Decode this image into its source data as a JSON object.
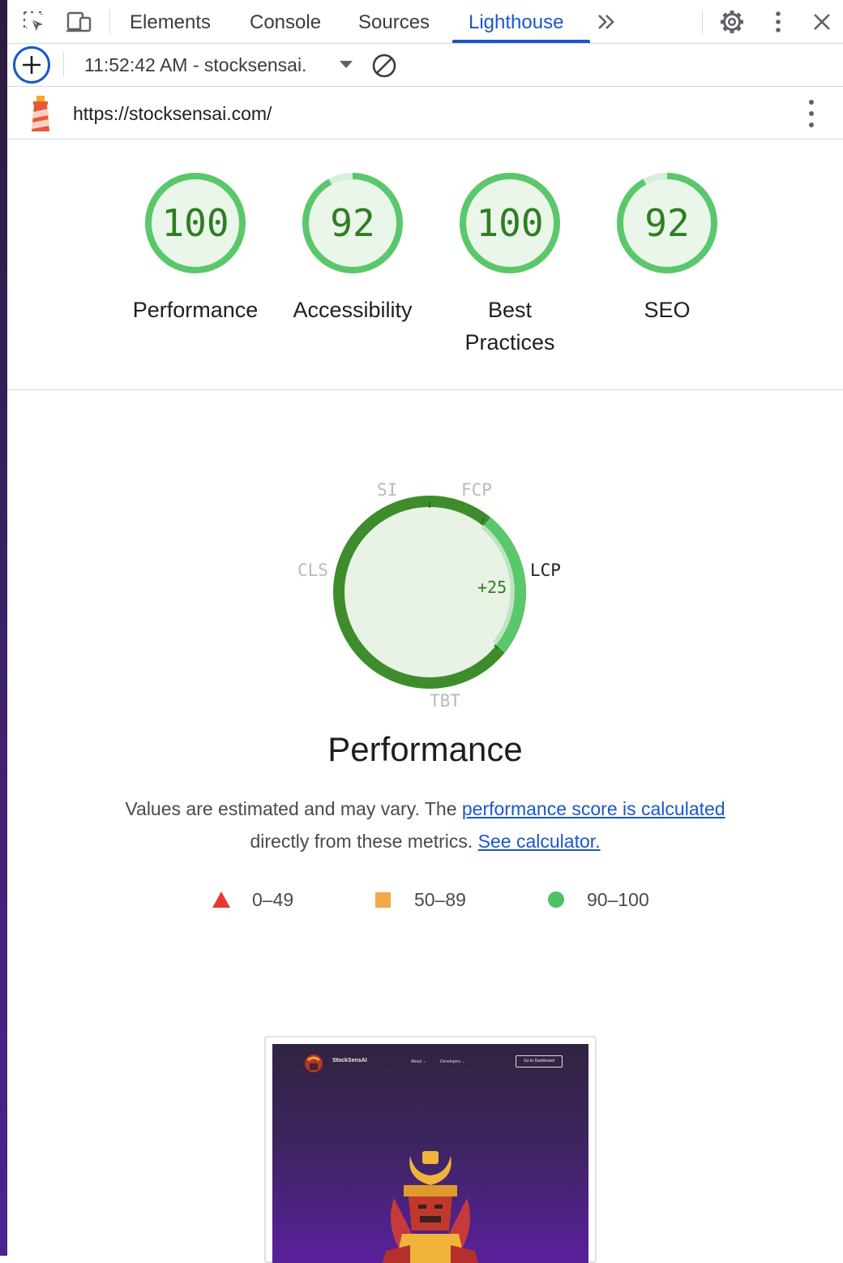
{
  "devtools": {
    "tabs": [
      {
        "label": "Elements"
      },
      {
        "label": "Console"
      },
      {
        "label": "Sources"
      },
      {
        "label": "Lighthouse"
      }
    ],
    "active_tab": "Lighthouse",
    "icons": [
      "inspect-element-icon",
      "device-toggle-icon",
      "more-tabs-icon",
      "settings-icon",
      "more-options-icon",
      "close-icon"
    ]
  },
  "toolbar": {
    "report_selector": "11:52:42 AM - stocksensai.",
    "icons": [
      "add-report-icon",
      "dropdown-caret-icon",
      "clear-reports-icon"
    ]
  },
  "report": {
    "url": "https://stocksensai.com/",
    "scores": [
      {
        "label": "Performance",
        "score": "100",
        "fraction": 1.0
      },
      {
        "label": "Accessibility",
        "score": "92",
        "fraction": 0.92
      },
      {
        "label": "Best Practices",
        "score": "100",
        "fraction": 1.0
      },
      {
        "label": "SEO",
        "score": "92",
        "fraction": 0.92
      }
    ],
    "metrics": {
      "labels": {
        "si": "SI",
        "fcp": "FCP",
        "lcp": "LCP",
        "tbt": "TBT",
        "cls": "CLS"
      },
      "highlighted": "LCP",
      "delta": "+25"
    },
    "performance_title": "Performance",
    "description": {
      "line1_text": "Values are estimated and may vary. The ",
      "link1": "performance score is calculated",
      "line2_text": "directly from these metrics. ",
      "link2": "See calculator."
    },
    "legend": [
      {
        "shape": "triangle",
        "color": "#e53935",
        "range": "0–49"
      },
      {
        "shape": "square",
        "color": "#f2a94a",
        "range": "50–89"
      },
      {
        "shape": "circle",
        "color": "#4fc164",
        "range": "90–100"
      }
    ],
    "thumbnail": {
      "brand": "StockSensAI",
      "nav": [
        "About",
        "Developers"
      ],
      "button": "Go to Dashboard"
    }
  },
  "colors": {
    "accent": "#1a57c9",
    "pass_green": "#2f7d22",
    "gauge_green": "#5bc76b"
  }
}
